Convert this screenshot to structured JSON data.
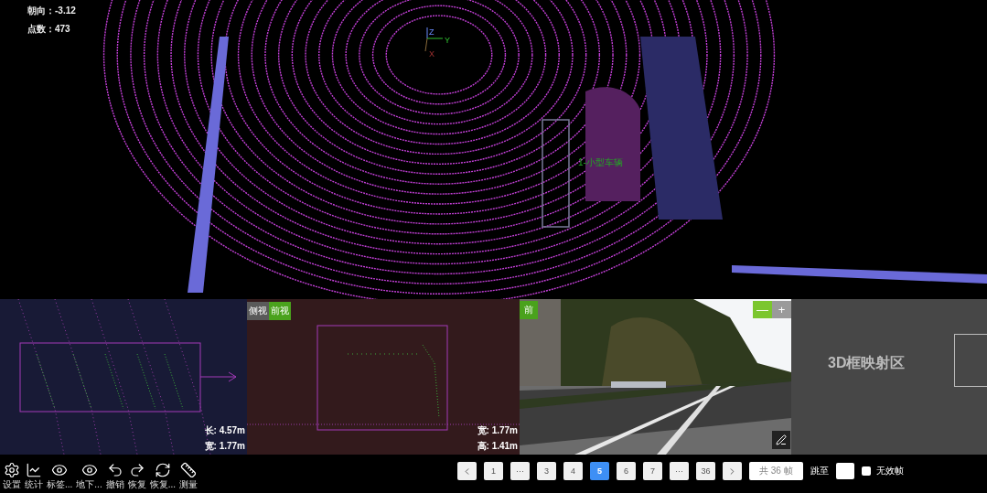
{
  "hud": {
    "heading": "朝向：-3.12",
    "points": "点数：473"
  },
  "axes": {
    "z": "Z",
    "y": "Y",
    "x": "X"
  },
  "object_label": "1-小型车辆",
  "side_view": {
    "measurements": [
      "长: 4.57m",
      "宽: 1.77m"
    ]
  },
  "front_view": {
    "tabs": [
      {
        "label": "侧视",
        "selected": false
      },
      {
        "label": "前视",
        "selected": true
      }
    ],
    "measurements": [
      "宽: 1.77m",
      "高: 1.41m"
    ]
  },
  "camera": {
    "badge": "前",
    "zoom": [
      {
        "label": "—",
        "selected": true
      },
      {
        "label": "+",
        "selected": false
      }
    ]
  },
  "projection": {
    "label": "3D框映射区"
  },
  "toolbar": [
    {
      "kind": "settings",
      "label": "设置"
    },
    {
      "kind": "stats",
      "label": "统计"
    },
    {
      "kind": "eye",
      "label": "标签..."
    },
    {
      "kind": "eye",
      "label": "地下..."
    },
    {
      "kind": "undo",
      "label": "撤销"
    },
    {
      "kind": "redo",
      "label": "恢复"
    },
    {
      "kind": "reset",
      "label": "恢复..."
    },
    {
      "kind": "ruler",
      "label": "测量"
    }
  ],
  "pagination": {
    "pages": [
      {
        "label": "1",
        "selected": false
      },
      {
        "label": "···",
        "selected": false
      },
      {
        "label": "3",
        "selected": false
      },
      {
        "label": "4",
        "selected": false
      },
      {
        "label": "5",
        "selected": true
      },
      {
        "label": "6",
        "selected": false
      },
      {
        "label": "7",
        "selected": false
      },
      {
        "label": "···",
        "selected": false
      },
      {
        "label": "36",
        "selected": false
      }
    ],
    "total": "共 36 帧",
    "jump_label": "跳至",
    "invalid_frame": {
      "label": "无效帧",
      "checked": false
    }
  }
}
